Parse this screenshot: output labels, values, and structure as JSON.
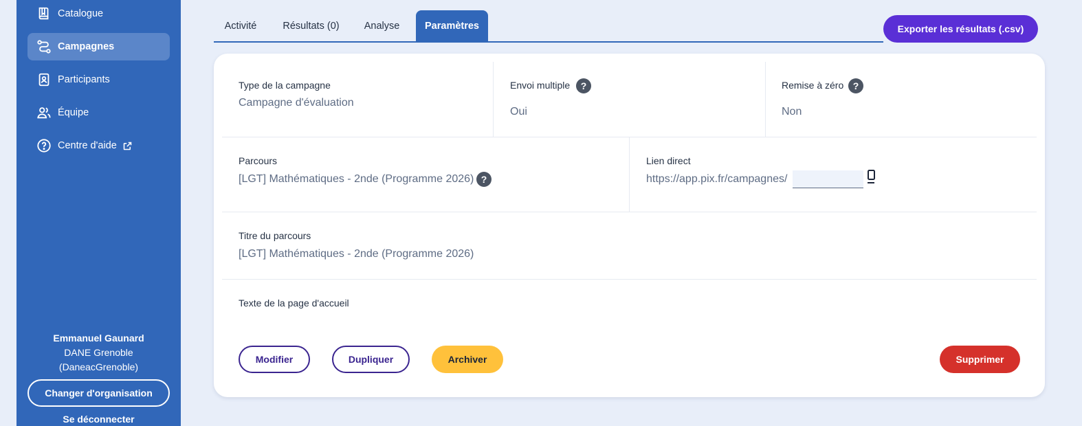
{
  "sidebar": {
    "items": [
      {
        "label": "Catalogue",
        "icon": "book-icon"
      },
      {
        "label": "Campagnes",
        "icon": "route-icon",
        "active": true
      },
      {
        "label": "Participants",
        "icon": "person-card-icon"
      },
      {
        "label": "Équipe",
        "icon": "team-icon"
      },
      {
        "label": "Centre d'aide",
        "icon": "help-circle-icon",
        "external_icon": "external-link-icon"
      }
    ],
    "user": {
      "name": "Emmanuel Gaunard",
      "org_line1": "DANE Grenoble",
      "org_line2": "(DaneacGrenoble)"
    },
    "change_org_label": "Changer d'organisation",
    "logout_label": "Se déconnecter"
  },
  "tabs": [
    {
      "label": "Activité"
    },
    {
      "label": "Résultats (0)"
    },
    {
      "label": "Analyse"
    },
    {
      "label": "Paramètres",
      "active": true
    }
  ],
  "export_label": "Exporter les résultats (.csv)",
  "settings": {
    "campaign_type": {
      "label": "Type de la campagne",
      "value": "Campagne d'évaluation"
    },
    "multiple_sending": {
      "label": "Envoi multiple",
      "value": "Oui",
      "help": "?"
    },
    "reset": {
      "label": "Remise à zéro",
      "value": "Non",
      "help": "?"
    },
    "path": {
      "label": "Parcours",
      "value": "[LGT] Mathématiques - 2nde (Programme 2026)",
      "help": "?"
    },
    "direct_link": {
      "label": "Lien direct",
      "value": "https://app.pix.fr/campagnes/"
    },
    "path_title": {
      "label": "Titre du parcours",
      "value": "[LGT] Mathématiques - 2nde (Programme 2026)"
    },
    "welcome_text": {
      "label": "Texte de la page d'accueil"
    }
  },
  "actions": {
    "modify": "Modifier",
    "duplicate": "Dupliquer",
    "archive": "Archiver",
    "delete": "Supprimer"
  },
  "colors": {
    "sidebar": "#3167b9",
    "export": "#5a2fd6",
    "archive": "#ffc13b",
    "delete": "#d5312b"
  }
}
